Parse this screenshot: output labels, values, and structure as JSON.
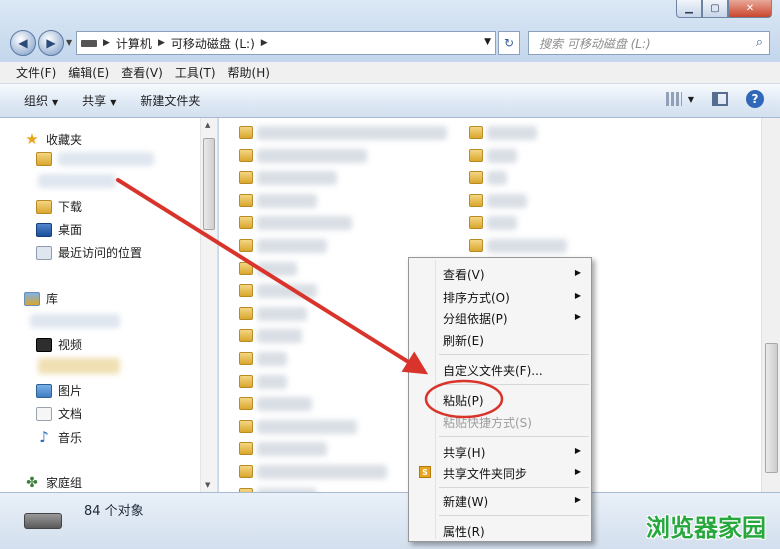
{
  "window": {
    "controls": [
      "minimize-icon",
      "maximize-icon",
      "close-icon"
    ]
  },
  "address": {
    "crumbs": [
      "计算机",
      "可移动磁盘 (L:)"
    ],
    "search_placeholder": "搜索 可移动磁盘 (L:)"
  },
  "menu": [
    "文件(F)",
    "编辑(E)",
    "查看(V)",
    "工具(T)",
    "帮助(H)"
  ],
  "toolbar": {
    "organize": "组织",
    "share": "共享",
    "new_folder": "新建文件夹"
  },
  "nav": {
    "favorites": "收藏夹",
    "downloads": "下载",
    "desktop": "桌面",
    "recent": "最近访问的位置",
    "libraries": "库",
    "videos": "视频",
    "pictures": "图片",
    "documents": "文档",
    "music": "音乐",
    "homegroup": "家庭组"
  },
  "status": {
    "count": "84 个对象"
  },
  "context_menu": {
    "view": "查看(V)",
    "sort": "排序方式(O)",
    "group": "分组依据(P)",
    "refresh": "刷新(E)",
    "customize": "自定义文件夹(F)...",
    "paste": "粘贴(P)",
    "paste_shortcut": "粘贴快捷方式(S)",
    "share": "共享(H)",
    "sync": "共享文件夹同步",
    "new": "新建(W)",
    "properties": "属性(R)"
  },
  "watermark": "浏览器家园",
  "colors": {
    "arrow": "#d9342b",
    "watermark": "#27a83e"
  }
}
